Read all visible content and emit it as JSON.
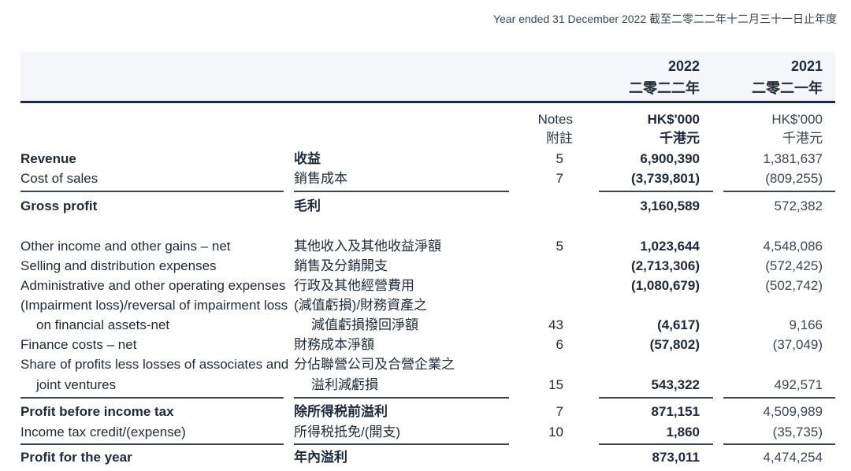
{
  "period_label": "Year ended 31 December 2022 截至二零二二年十二月三十一日止年度",
  "header": {
    "year_2022": "2022",
    "year_2022_zh": "二零二二年",
    "year_2021": "2021",
    "year_2021_zh": "二零二一年",
    "notes_en": "Notes",
    "notes_zh": "附註",
    "unit_en": "HK$'000",
    "unit_zh": "千港元"
  },
  "rows": [
    {
      "en": "Revenue",
      "zh": "收益",
      "note": "5",
      "v2022": "6,900,390",
      "v2021": "1,381,637"
    },
    {
      "en": "Cost of sales",
      "zh": "銷售成本",
      "note": "7",
      "v2022": "(3,739,801)",
      "v2021": "(809,255)"
    },
    {
      "en": "Gross profit",
      "zh": "毛利",
      "note": "",
      "v2022": "3,160,589",
      "v2021": "572,382"
    },
    {
      "en": "Other income and other gains – net",
      "zh": "其他收入及其他收益淨額",
      "note": "5",
      "v2022": "1,023,644",
      "v2021": "4,548,086"
    },
    {
      "en": "Selling and distribution expenses",
      "zh": "銷售及分銷開支",
      "note": "",
      "v2022": "(2,713,306)",
      "v2021": "(572,425)"
    },
    {
      "en": "Administrative and other operating expenses",
      "zh": "行政及其他經營費用",
      "note": "",
      "v2022": "(1,080,679)",
      "v2021": "(502,742)"
    },
    {
      "en": "(Impairment loss)/reversal of impairment loss",
      "zh": "(減值虧損)/財務資產之",
      "note": "",
      "v2022": "",
      "v2021": ""
    },
    {
      "en": "on financial assets-net",
      "zh": "減值虧損撥回淨額",
      "note": "43",
      "v2022": "(4,617)",
      "v2021": "9,166"
    },
    {
      "en": "Finance costs – net",
      "zh": "財務成本淨額",
      "note": "6",
      "v2022": "(57,802)",
      "v2021": "(37,049)"
    },
    {
      "en": "Share of profits less losses of associates and",
      "zh": "分佔聯營公司及合營企業之",
      "note": "",
      "v2022": "",
      "v2021": ""
    },
    {
      "en": "joint ventures",
      "zh": "溢利減虧損",
      "note": "15",
      "v2022": "543,322",
      "v2021": "492,571"
    },
    {
      "en": "Profit before income tax",
      "zh": "除所得税前溢利",
      "note": "7",
      "v2022": "871,151",
      "v2021": "4,509,989"
    },
    {
      "en": "Income tax credit/(expense)",
      "zh": "所得税抵免/(開支)",
      "note": "10",
      "v2022": "1,860",
      "v2021": "(35,735)"
    },
    {
      "en": "Profit for the year",
      "zh": "年內溢利",
      "note": "",
      "v2022": "873,011",
      "v2021": "4,474,254"
    }
  ]
}
